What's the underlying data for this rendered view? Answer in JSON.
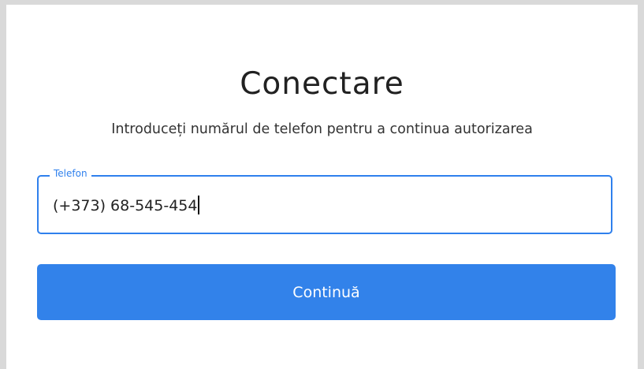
{
  "login": {
    "title": "Conectare",
    "subtitle": "Introduceți numărul de telefon pentru a continua autorizarea",
    "phone_field": {
      "label": "Telefon",
      "value": "(+373) 68-545-454"
    },
    "continue_label": "Continuă"
  },
  "colors": {
    "accent": "#2f80ed",
    "button": "#3282ea",
    "background": "#ffffff",
    "outer_background": "#d9d9d9"
  }
}
